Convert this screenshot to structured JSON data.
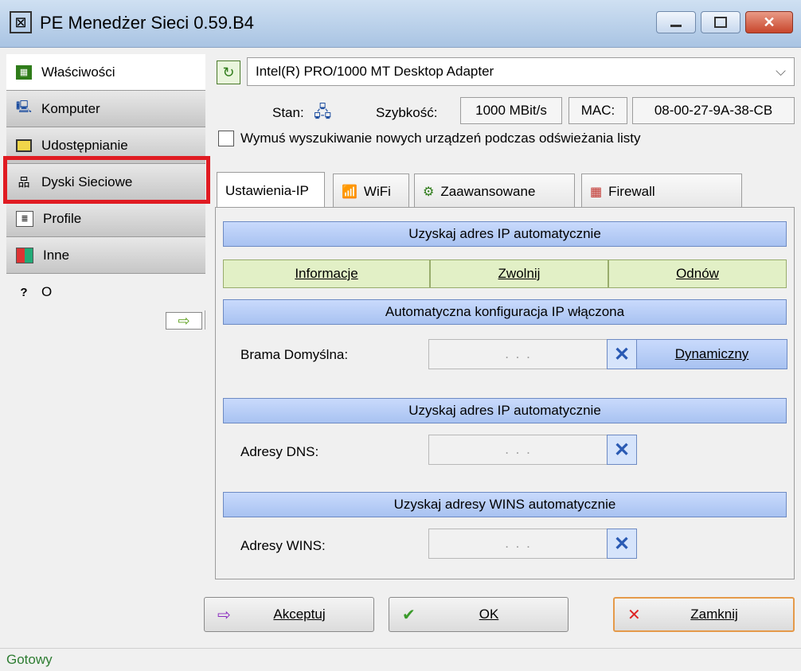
{
  "window": {
    "title": "PE Menedżer Sieci 0.59.B4",
    "minimize_label": "▭",
    "maximize_label": "▣",
    "close_label": "✕"
  },
  "sidebar": {
    "items": [
      {
        "label": "Właściwości",
        "icon": "properties-icon"
      },
      {
        "label": "Komputer",
        "icon": "computer-icon"
      },
      {
        "label": "Udostępnianie",
        "icon": "sharing-icon"
      },
      {
        "label": "Dyski Sieciowe",
        "icon": "network-drives-icon"
      },
      {
        "label": "Profile",
        "icon": "profile-icon"
      },
      {
        "label": "Inne",
        "icon": "other-icon"
      },
      {
        "label": "O",
        "icon": "about-icon"
      }
    ],
    "highlighted_item": "Dyski Sieciowe",
    "arrow": "⇨"
  },
  "adapter": {
    "selected": "Intel(R) PRO/1000 MT Desktop Adapter",
    "state_label": "Stan:",
    "speed_label": "Szybkość:",
    "speed_value": "1000 MBit/s",
    "mac_label": "MAC:",
    "mac_value": "08-00-27-9A-38-CB",
    "force_search_label": "Wymuś wyszukiwanie nowych urządzeń podczas odświeżania listy",
    "force_search_checked": false
  },
  "tabs": [
    {
      "label": "Ustawienia-IP",
      "active": true
    },
    {
      "label": "WiFi",
      "active": false
    },
    {
      "label": "Zaawansowane",
      "active": false
    },
    {
      "label": "Firewall",
      "active": false
    }
  ],
  "ip_settings": {
    "auto_ip_bar": "Uzyskaj adres IP automatycznie",
    "actions": [
      "Informacje",
      "Zwolnij",
      "Odnów"
    ],
    "auto_config_bar": "Automatyczna konfiguracja IP włączona",
    "gateway_label": "Brama Domyślna:",
    "dynamic_button": "Dynamiczny",
    "auto_dns_bar": "Uzyskaj adres IP automatycznie",
    "dns_label": "Adresy DNS:",
    "auto_wins_bar": "Uzyskaj adresy WINS automatycznie",
    "wins_label": "Adresy WINS:",
    "ip_dots": ".   .   ."
  },
  "buttons": {
    "accept": "Akceptuj",
    "ok": "OK",
    "close": "Zamknij"
  },
  "status": "Gotowy",
  "colors": {
    "highlight": "#e01b22",
    "status_text": "#2e7d32",
    "blue_bar": "#a8c2f1",
    "green_cell": "#e2f0c6"
  }
}
